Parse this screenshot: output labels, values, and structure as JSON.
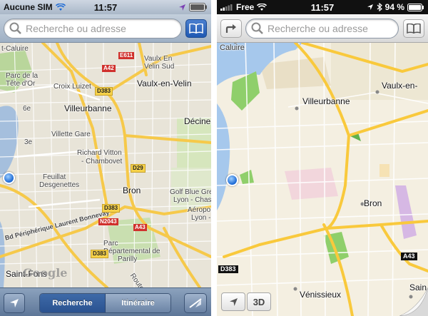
{
  "left": {
    "status": {
      "carrier": "Aucune SIM",
      "time": "11:57"
    },
    "search": {
      "placeholder": "Recherche ou adresse"
    },
    "toolbar": {
      "search_tab": "Recherche",
      "route_tab": "Itinéraire"
    },
    "watermark": "Google",
    "labels": {
      "caluire": "t-Caluire",
      "parc_tete_dor": "Parc de la",
      "tete_dor": "Tête d'Or",
      "croix_luizet": "Croix Luizet",
      "vaulx": "Vaulx-en-Velin",
      "vaulx_en": "Vaulx En",
      "velin_sud": "Velin Sud",
      "villeurbanne": "Villeurbanne",
      "decines": "Décines",
      "sixe": "6e",
      "villette": "Villette Gare",
      "troisiemee": "3e",
      "richard": "Richard Vitton",
      "chambovet": "- Chambovet",
      "feuillat": "Feuillat",
      "desgenettes": "Desgenettes",
      "bron": "Bron",
      "golf": "Golf Blue Green",
      "lyon_chass": "Lyon - Chass",
      "aeroport": "Aéroport",
      "lyon_bron": "Lyon - Bron",
      "bd": "Bd Périphérique Laurent Bonnevay",
      "parc_dep": "Parc",
      "parc_dep2": "Départemental de",
      "parilly": "Parilly",
      "saint_fons": "Saint-Fons",
      "route_de": "Route de"
    },
    "shields": {
      "e611": "E611",
      "a42": "A42",
      "d383a": "D383",
      "d29": "D29",
      "d383b": "D383",
      "n2043": "N2043",
      "a43": "A43",
      "d383c": "D383"
    }
  },
  "right": {
    "status": {
      "carrier": "Free",
      "time": "11:57",
      "battery": "94 %"
    },
    "search": {
      "placeholder": "Recherche ou adresse"
    },
    "labels": {
      "caluire": "Caluire",
      "vaulx": "Vaulx-en-",
      "villeurbanne": "Villeurbanne",
      "bron": "Bron",
      "venissieux": "Vénissieux",
      "sain": "Sain"
    },
    "shields": {
      "a43": "A43",
      "d383": "D383"
    },
    "three_d": "3D"
  },
  "colors": {
    "google_road": "#f6d24a",
    "apple_road": "#f9c93c",
    "park": "#8fcf6b"
  }
}
